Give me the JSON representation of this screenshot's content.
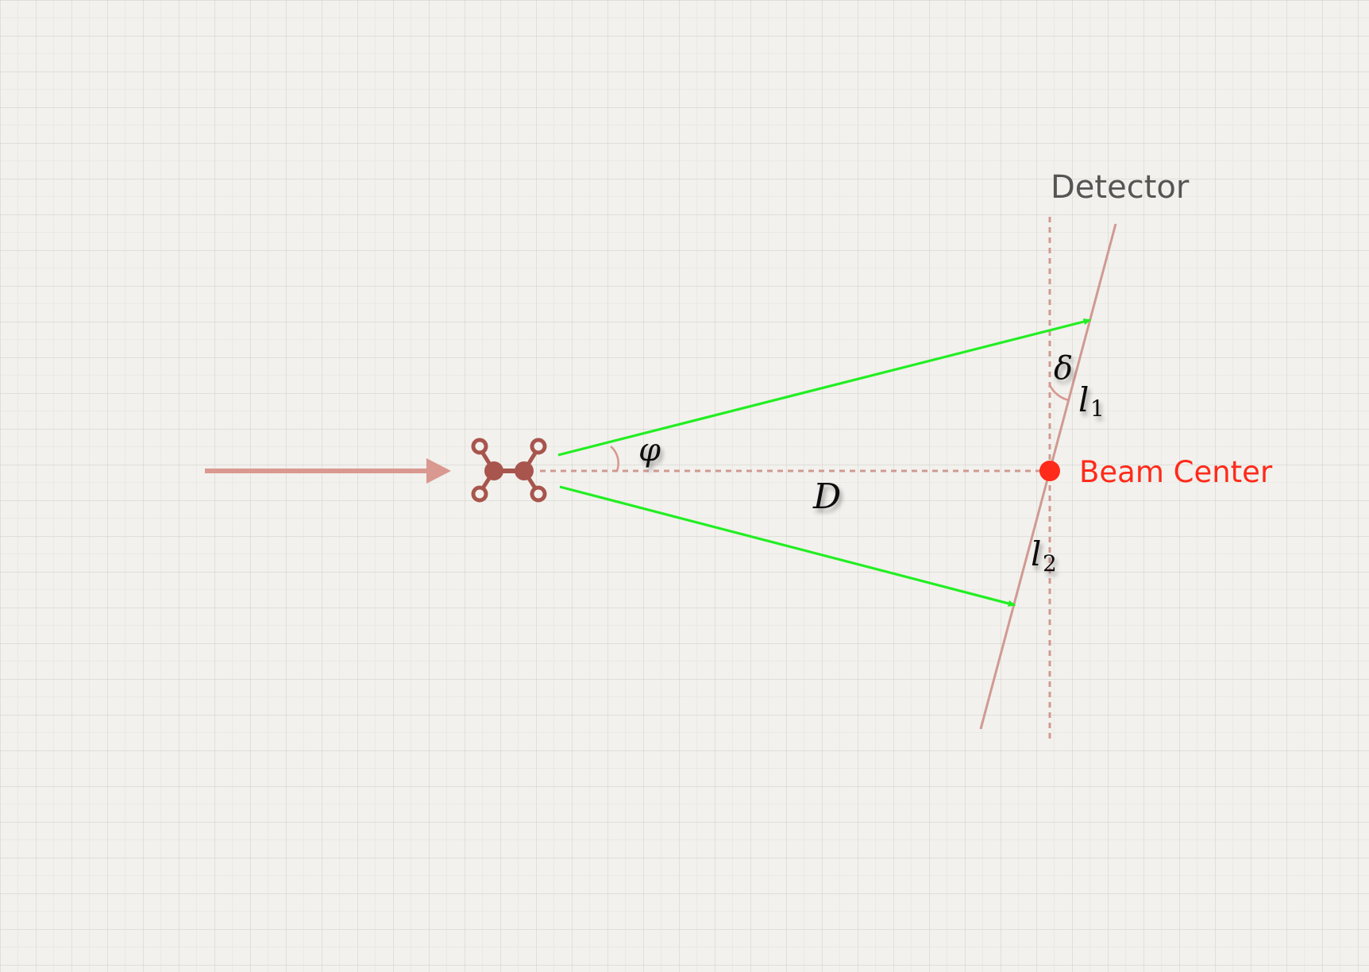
{
  "labels": {
    "detector": "Detector",
    "beam_center": "Beam Center",
    "phi": "φ",
    "delta": "δ",
    "distance": "D",
    "l1_base": "l",
    "l1_sub": "1",
    "l2_base": "l",
    "l2_sub": "2"
  },
  "colors": {
    "background": "#f2f1ed",
    "grid": "#dcdcd6",
    "incoming_beam": "#d99890",
    "molecule": "#a8554d",
    "detector_line": "#d09a92",
    "dashed_axis": "#d09a92",
    "scattered_rays": "#22ee22",
    "beam_center": "#ff2a1a",
    "detector_label": "#555555",
    "math_text": "#111111"
  },
  "icons": {
    "sample": "molecule-icon",
    "incoming_arrow": "arrow-right-icon"
  }
}
